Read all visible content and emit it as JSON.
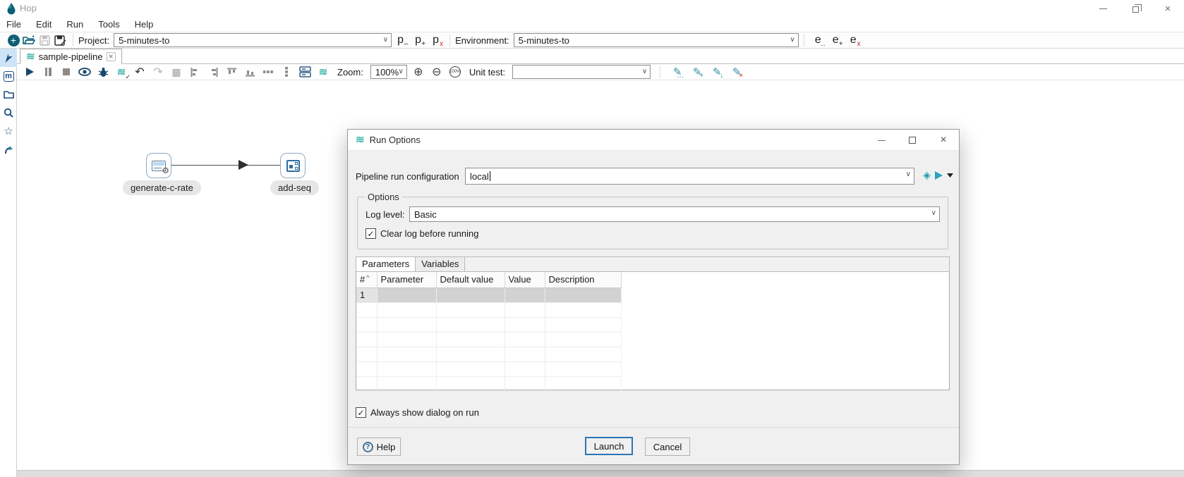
{
  "window": {
    "title": "Hop"
  },
  "menu": {
    "items": [
      "File",
      "Edit",
      "Run",
      "Tools",
      "Help"
    ]
  },
  "main_toolbar": {
    "project_label": "Project:",
    "project_value": "5-minutes-to",
    "project_buttons": [
      {
        "name": "edit-project",
        "glyph": "p",
        "sub": "‒"
      },
      {
        "name": "add-project",
        "glyph": "p",
        "sub": "+"
      },
      {
        "name": "delete-project",
        "glyph": "p",
        "sub": "x"
      }
    ],
    "environment_label": "Environment:",
    "environment_value": "5-minutes-to",
    "environment_buttons": [
      {
        "name": "edit-environment",
        "glyph": "e",
        "sub": "‥"
      },
      {
        "name": "add-environment",
        "glyph": "e",
        "sub": "+"
      },
      {
        "name": "delete-environment",
        "glyph": "e",
        "sub": "x"
      }
    ]
  },
  "tab": {
    "label": "sample-pipeline",
    "close_glyph": "×"
  },
  "pipeline_toolbar": {
    "zoom_label": "Zoom:",
    "zoom_value": "100%",
    "zoom_reset_label": "100%",
    "unit_test_label": "Unit test:",
    "unit_test_value": "",
    "pencil_subs": [
      "…",
      "+",
      "↓",
      "×"
    ]
  },
  "canvas": {
    "nodes": [
      {
        "label": "generate-c-rate"
      },
      {
        "label": "add-seq"
      }
    ]
  },
  "dialog": {
    "title": "Run Options",
    "run_config_label": "Pipeline run configuration",
    "run_config_value": "local",
    "options_legend": "Options",
    "log_level_label": "Log level:",
    "log_level_value": "Basic",
    "clear_log_label": "Clear log before running",
    "tabs": [
      {
        "label": "Parameters"
      },
      {
        "label": "Variables"
      }
    ],
    "table": {
      "columns": [
        "#",
        "Parameter",
        "Default value",
        "Value",
        "Description"
      ],
      "rows": [
        [
          "1",
          "",
          "",
          "",
          ""
        ]
      ]
    },
    "always_show_label": "Always show dialog on run",
    "help_label": "Help",
    "launch_label": "Launch",
    "cancel_label": "Cancel"
  },
  "icons": {
    "chevron": "∨",
    "waves": "≋",
    "check": "✓",
    "undo": "↶",
    "redo": "↷",
    "grid": "▦",
    "zoom_in": "⊕",
    "zoom_out": "⊖",
    "pencil": "✎",
    "gear": "⚙",
    "question": "?",
    "star": "☆",
    "diamond": "◈",
    "plus": "+",
    "sort_caret": "^",
    "close": "×"
  },
  "colors": {
    "accent_teal": "#46b8b0",
    "brand_blue": "#15486e",
    "row_highlight": "#d2d2d2",
    "launch_border": "#2e75b6",
    "selection_bg": "#cde4f7"
  }
}
